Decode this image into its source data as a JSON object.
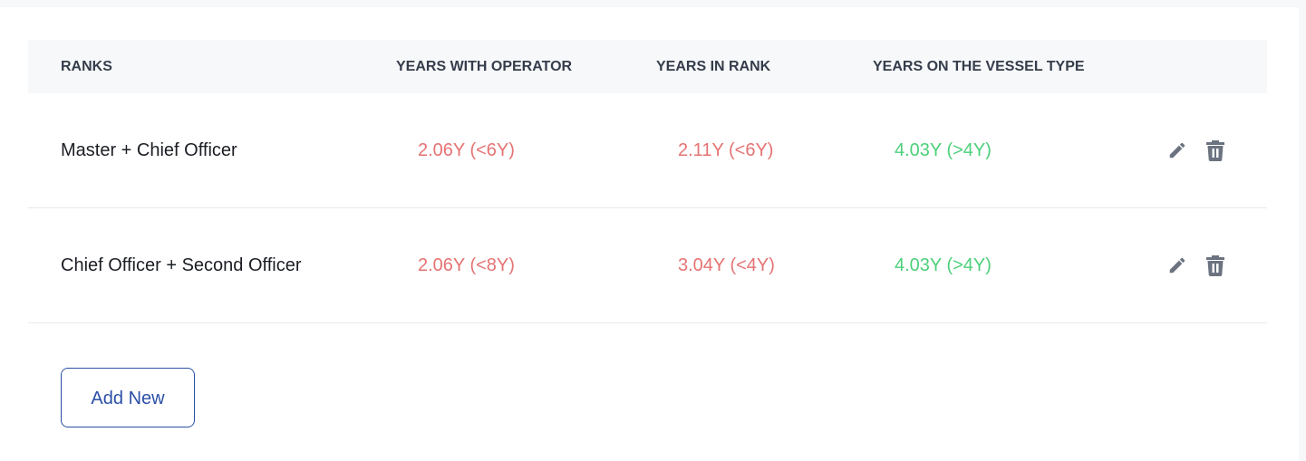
{
  "table": {
    "headers": {
      "ranks": "RANKS",
      "years_with_operator": "YEARS WITH OPERATOR",
      "years_in_rank": "YEARS IN RANK",
      "years_on_vessel_type": "YEARS ON THE VESSEL TYPE"
    },
    "rows": [
      {
        "ranks": "Master + Chief Officer",
        "years_with_operator": "2.06Y (<6Y)",
        "years_with_operator_status": "fail",
        "years_in_rank": "2.11Y (<6Y)",
        "years_in_rank_status": "fail",
        "years_on_vessel_type": "4.03Y (>4Y)",
        "years_on_vessel_type_status": "pass",
        "actions": [
          "edit-icon",
          "trash-icon"
        ]
      },
      {
        "ranks": "Chief Officer + Second Officer",
        "years_with_operator": "2.06Y (<8Y)",
        "years_with_operator_status": "fail",
        "years_in_rank": "3.04Y (<4Y)",
        "years_in_rank_status": "fail",
        "years_on_vessel_type": "4.03Y (>4Y)",
        "years_on_vessel_type_status": "pass",
        "actions": [
          "edit-icon",
          "trash-icon"
        ]
      }
    ]
  },
  "add_button_label": "Add New",
  "colors": {
    "fail": "#e57373",
    "pass": "#4cd07a",
    "accent": "#2b4fa6",
    "icon": "#6b7280",
    "header_bg": "#f7f8fa"
  }
}
